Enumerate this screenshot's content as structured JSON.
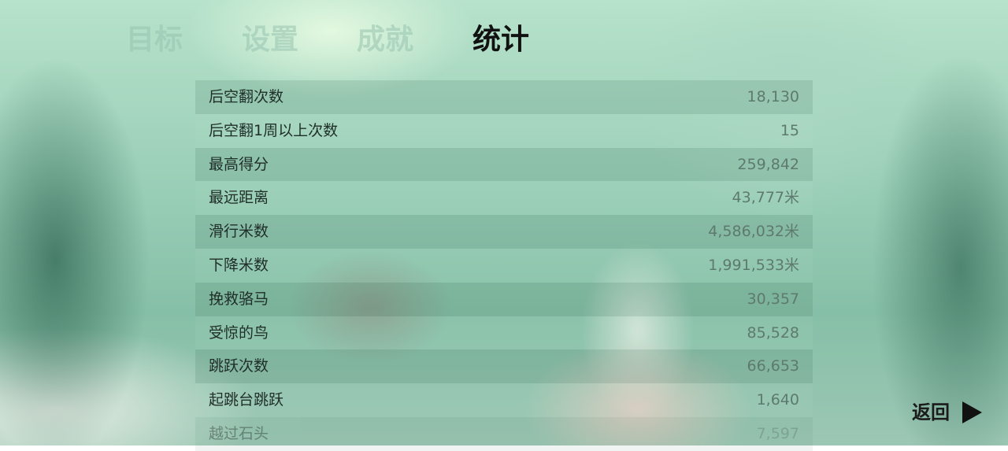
{
  "tabs": [
    {
      "label": "目标",
      "active": false
    },
    {
      "label": "设置",
      "active": false
    },
    {
      "label": "成就",
      "active": false
    },
    {
      "label": "统计",
      "active": true
    }
  ],
  "stats": [
    {
      "label": "后空翻次数",
      "value": "18,130"
    },
    {
      "label": "后空翻1周以上次数",
      "value": "15"
    },
    {
      "label": "最高得分",
      "value": "259,842"
    },
    {
      "label": "最远距离",
      "value": "43,777米"
    },
    {
      "label": "滑行米数",
      "value": "4,586,032米"
    },
    {
      "label": "下降米数",
      "value": "1,991,533米"
    },
    {
      "label": "挽救骆马",
      "value": "30,357"
    },
    {
      "label": "受惊的鸟",
      "value": "85,528"
    },
    {
      "label": "跳跃次数",
      "value": "66,653"
    },
    {
      "label": "起跳台跳跃",
      "value": "1,640"
    },
    {
      "label": "越过石头",
      "value": "7,597"
    }
  ],
  "back": {
    "label": "返回",
    "icon": "play-triangle-icon"
  }
}
